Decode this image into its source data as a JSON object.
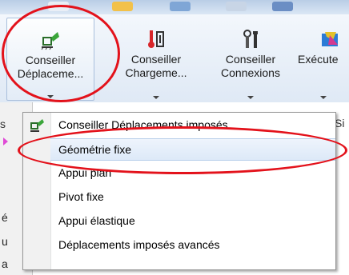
{
  "window": {
    "title": "",
    "accent_color": "#e3121b",
    "selection_color": "#dde9f8"
  },
  "ribbon": {
    "buttons": [
      {
        "line1": "Conseiller",
        "line2": "Déplaceme...",
        "icon": "fixture-advisor-icon",
        "active": true
      },
      {
        "line1": "Conseiller",
        "line2": "Chargeme...",
        "icon": "load-advisor-icon",
        "active": false
      },
      {
        "line1": "Conseiller",
        "line2": "Connexions",
        "icon": "connections-advisor-icon",
        "active": false
      },
      {
        "line1": "Exécute",
        "line2": "",
        "icon": "run-icon",
        "active": false
      }
    ]
  },
  "background_fragments": {
    "left_tab": "s",
    "left_lines": [
      "é",
      "u",
      "a"
    ],
    "right_tab": "Si"
  },
  "menu": {
    "items": [
      {
        "label": "Conseiller Déplacements imposés",
        "icon": "fixture-advisor-icon",
        "highlighted": false
      },
      {
        "label": "Géométrie fixe",
        "icon": "",
        "highlighted": true
      },
      {
        "label": "Appui plan",
        "icon": "",
        "highlighted": false
      },
      {
        "label": "Pivot fixe",
        "icon": "",
        "highlighted": false
      },
      {
        "label": "Appui élastique",
        "icon": "",
        "highlighted": false
      },
      {
        "label": "Déplacements imposés avancés",
        "icon": "",
        "highlighted": false
      }
    ]
  }
}
